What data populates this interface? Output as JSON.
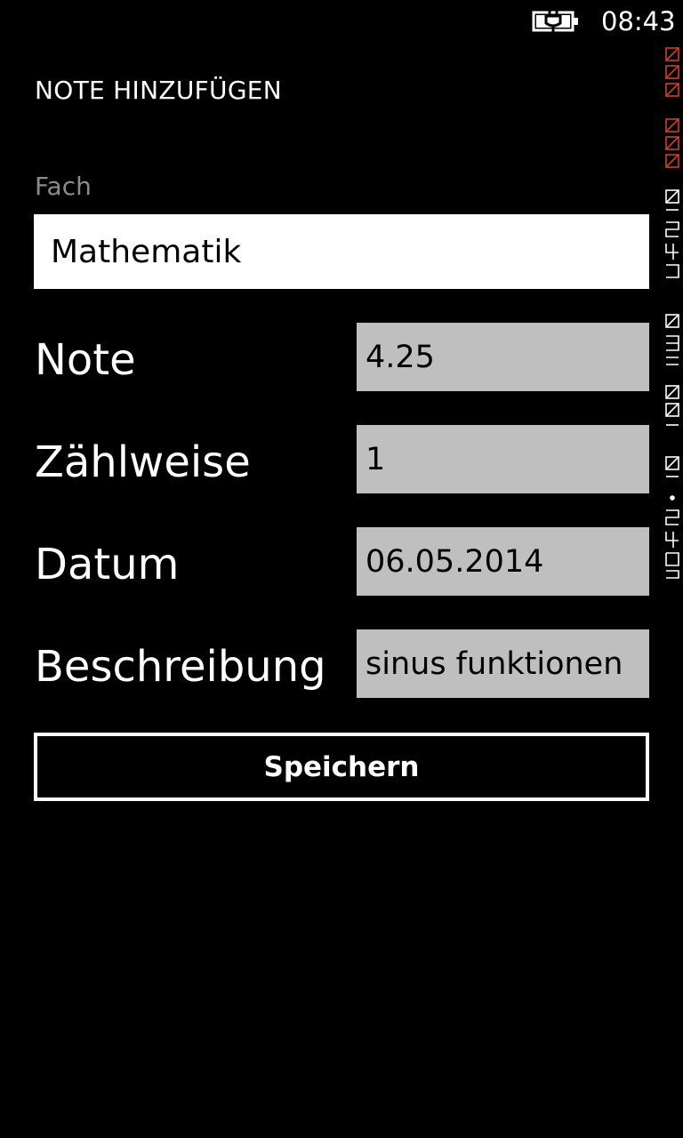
{
  "status_bar": {
    "time": "08:43",
    "battery_icon": "battery-charging-icon"
  },
  "page": {
    "title": "NOTE HINZUFÜGEN"
  },
  "form": {
    "fach": {
      "label": "Fach",
      "value": "Mathematik"
    },
    "rows": [
      {
        "label": "Note",
        "value": "4.25"
      },
      {
        "label": "Zählweise",
        "value": "1"
      },
      {
        "label": "Datum",
        "value": "06.05.2014"
      },
      {
        "label": "Beschreibung",
        "value": "sinus funktionen"
      }
    ],
    "save_label": "Speichern"
  },
  "colors": {
    "background": "#000000",
    "input_fill": "#bfbfbf",
    "label_gray": "#8c8c8c",
    "debug_red": "#d0402a"
  }
}
